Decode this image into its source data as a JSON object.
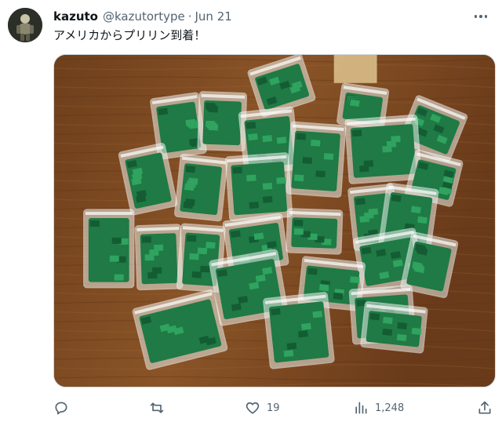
{
  "tweet": {
    "display_name": "kazuto",
    "handle": "@kazutortype",
    "separator": "·",
    "date": "Jun 21",
    "text": "アメリカからプリリン到着！",
    "avatar_icon": "user-avatar",
    "more_icon": "more-dots-icon"
  },
  "media": {
    "alt": "photo of many small plastic bags of green bricks on a wooden table"
  },
  "actions": {
    "reply": {
      "icon": "reply-icon",
      "count": ""
    },
    "retweet": {
      "icon": "retweet-icon",
      "count": ""
    },
    "like": {
      "icon": "heart-icon",
      "count": "19"
    },
    "views": {
      "icon": "views-icon",
      "count": "1,248"
    },
    "share": {
      "icon": "share-icon"
    }
  },
  "colors": {
    "text_primary": "#0f1419",
    "text_secondary": "#536471",
    "border": "#cfd9de",
    "table_wood": "#7a4a23",
    "brick_green": "#1f7a45"
  }
}
